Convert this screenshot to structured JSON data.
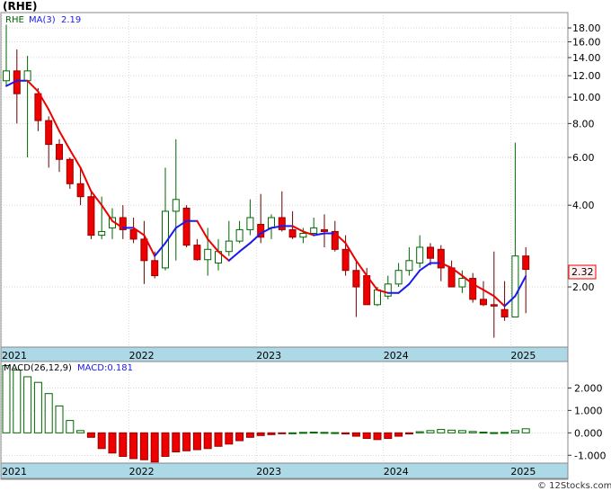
{
  "header": {
    "ticker_title": "(RHE)",
    "legend_ticker": "RHE",
    "legend_ma": "MA(3)",
    "legend_ma_value": "2.19"
  },
  "macd_header": {
    "label": "MACD(26,12,9)",
    "value_label": "MACD:0.181"
  },
  "last_price_tag": "2.32",
  "credit": "© 12Stocks.com",
  "colors": {
    "up_candle": "#ffffff",
    "up_border": "#006600",
    "down_candle": "#ee0000",
    "ma_up": "#1a1aee",
    "ma_down": "#ee0000",
    "axis_strip": "#add8e6",
    "grid": "#c0c0c0",
    "macd_pos": "#006600",
    "macd_neg": "#ee0000"
  },
  "chart_data": [
    {
      "type": "candlestick",
      "title": "(RHE)",
      "scale": "log",
      "x_ticks": [
        "2021",
        "2022",
        "2023",
        "2024",
        "2025"
      ],
      "y_ticks": [
        "18.00",
        "16.00",
        "14.00",
        "12.00",
        "10.00",
        "8.00",
        "6.00",
        "4.00",
        "2.00"
      ],
      "y_tick_values": [
        18,
        16,
        14,
        12,
        10,
        8,
        6,
        4,
        2
      ],
      "ylim": [
        1.2,
        20.5
      ],
      "x_tick_index": [
        0,
        12,
        24,
        36,
        48
      ],
      "months": [
        "2021-01",
        "2021-02",
        "2021-03",
        "2021-04",
        "2021-05",
        "2021-06",
        "2021-07",
        "2021-08",
        "2021-09",
        "2021-10",
        "2021-11",
        "2021-12",
        "2022-01",
        "2022-02",
        "2022-03",
        "2022-04",
        "2022-05",
        "2022-06",
        "2022-07",
        "2022-08",
        "2022-09",
        "2022-10",
        "2022-11",
        "2022-12",
        "2023-01",
        "2023-02",
        "2023-03",
        "2023-04",
        "2023-05",
        "2023-06",
        "2023-07",
        "2023-08",
        "2023-09",
        "2023-10",
        "2023-11",
        "2023-12",
        "2024-01",
        "2024-02",
        "2024-03",
        "2024-04",
        "2024-05",
        "2024-06",
        "2024-07",
        "2024-08",
        "2024-09",
        "2024-10",
        "2024-11",
        "2024-12",
        "2025-01",
        "2025-02"
      ],
      "open": [
        11.5,
        12.5,
        11.5,
        10.3,
        8.2,
        6.7,
        5.9,
        4.8,
        4.3,
        3.1,
        3.3,
        3.6,
        3.25,
        3.0,
        2.5,
        2.35,
        3.8,
        3.9,
        2.85,
        2.52,
        2.45,
        2.7,
        2.95,
        3.25,
        3.4,
        3.3,
        3.6,
        3.25,
        3.05,
        3.15,
        3.25,
        3.2,
        2.75,
        2.3,
        2.2,
        1.72,
        1.85,
        2.05,
        2.3,
        2.45,
        2.8,
        2.75,
        2.35,
        2.0,
        2.15,
        1.8,
        1.72,
        1.65,
        1.55,
        2.6
      ],
      "close": [
        12.5,
        10.3,
        12.5,
        8.2,
        6.7,
        5.9,
        4.8,
        4.3,
        3.1,
        3.2,
        3.6,
        3.25,
        3.0,
        2.5,
        2.2,
        3.8,
        4.2,
        2.85,
        2.52,
        2.75,
        2.7,
        2.95,
        3.25,
        3.6,
        3.05,
        3.6,
        3.25,
        3.05,
        3.15,
        3.3,
        3.2,
        2.75,
        2.3,
        2.0,
        1.72,
        1.95,
        2.05,
        2.3,
        2.5,
        2.8,
        2.55,
        2.35,
        2.0,
        2.15,
        1.8,
        1.72,
        1.7,
        1.55,
        2.6,
        2.32
      ],
      "high": [
        18.5,
        15.0,
        14.2,
        10.8,
        8.5,
        7.0,
        6.0,
        5.5,
        4.5,
        4.3,
        3.9,
        4.0,
        3.6,
        3.5,
        2.7,
        5.5,
        7.0,
        4.0,
        3.0,
        3.3,
        3.0,
        3.5,
        3.5,
        4.2,
        4.4,
        3.7,
        4.5,
        3.8,
        3.3,
        3.6,
        3.7,
        3.5,
        3.1,
        2.5,
        2.35,
        2.0,
        2.2,
        2.45,
        2.8,
        3.1,
        2.9,
        2.85,
        2.5,
        2.3,
        2.25,
        2.1,
        2.7,
        2.1,
        6.8,
        2.8
      ],
      "low": [
        11.0,
        8.0,
        6.0,
        7.5,
        5.5,
        5.3,
        4.6,
        4.0,
        3.0,
        3.0,
        3.0,
        3.0,
        2.9,
        2.05,
        2.15,
        2.3,
        2.5,
        2.8,
        2.5,
        2.2,
        2.3,
        2.6,
        2.9,
        3.1,
        2.9,
        3.0,
        3.2,
        3.0,
        2.9,
        3.1,
        2.8,
        2.7,
        2.2,
        1.55,
        1.8,
        1.7,
        1.8,
        2.0,
        2.2,
        2.35,
        2.4,
        2.1,
        2.0,
        1.9,
        1.75,
        1.7,
        1.3,
        1.5,
        1.55,
        1.6
      ],
      "ma3": [
        11.0,
        11.5,
        11.5,
        10.5,
        9.0,
        7.5,
        6.4,
        5.5,
        4.5,
        4.0,
        3.5,
        3.3,
        3.3,
        3.1,
        2.6,
        2.9,
        3.3,
        3.5,
        3.5,
        3.0,
        2.7,
        2.5,
        2.7,
        2.9,
        3.15,
        3.3,
        3.35,
        3.35,
        3.2,
        3.1,
        3.15,
        3.15,
        2.9,
        2.5,
        2.2,
        1.95,
        1.9,
        1.9,
        2.05,
        2.3,
        2.45,
        2.45,
        2.35,
        2.2,
        2.05,
        1.95,
        1.85,
        1.7,
        1.85,
        2.19
      ]
    },
    {
      "type": "bar",
      "title": "MACD(26,12,9)",
      "y_ticks": [
        "2.000",
        "1.000",
        "0.000",
        "-1.000"
      ],
      "y_tick_values": [
        2,
        1,
        0,
        -1
      ],
      "ylim": [
        -1.35,
        3.1
      ],
      "x_ticks": [
        "2021",
        "2022",
        "2023",
        "2024",
        "2025"
      ],
      "x_tick_index": [
        0,
        12,
        24,
        36,
        48
      ],
      "values": [
        3.0,
        2.8,
        2.5,
        2.25,
        1.75,
        1.2,
        0.55,
        0.1,
        -0.2,
        -0.7,
        -0.9,
        -1.05,
        -1.15,
        -1.2,
        -1.3,
        -1.05,
        -0.85,
        -0.8,
        -0.75,
        -0.7,
        -0.6,
        -0.5,
        -0.35,
        -0.2,
        -0.12,
        -0.08,
        -0.04,
        0.0,
        0.02,
        0.03,
        0.02,
        0.01,
        -0.05,
        -0.15,
        -0.25,
        -0.3,
        -0.25,
        -0.15,
        -0.05,
        0.05,
        0.1,
        0.15,
        0.12,
        0.1,
        0.06,
        0.03,
        0.01,
        0.02,
        0.1,
        0.181
      ]
    }
  ]
}
